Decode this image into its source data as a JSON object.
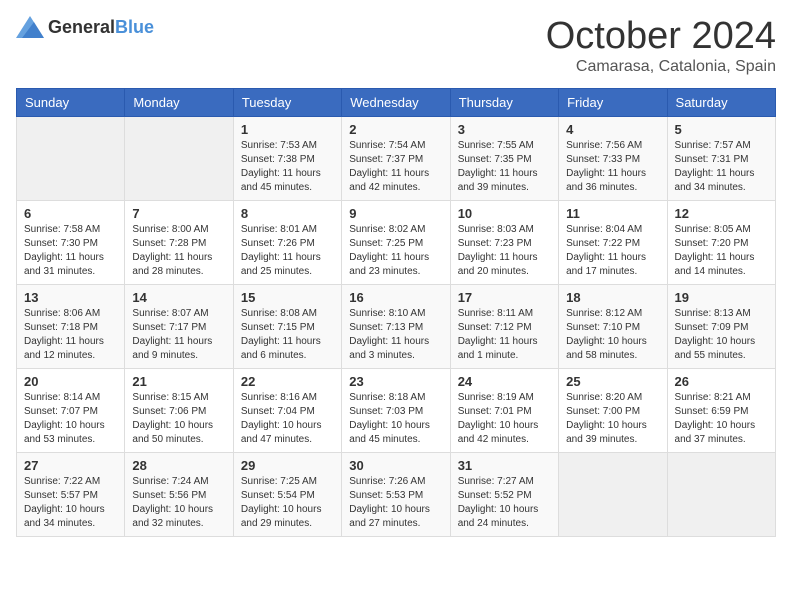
{
  "logo": {
    "general": "General",
    "blue": "Blue"
  },
  "header": {
    "month": "October 2024",
    "location": "Camarasa, Catalonia, Spain"
  },
  "weekdays": [
    "Sunday",
    "Monday",
    "Tuesday",
    "Wednesday",
    "Thursday",
    "Friday",
    "Saturday"
  ],
  "weeks": [
    [
      {
        "day": "",
        "sunrise": "",
        "sunset": "",
        "daylight": ""
      },
      {
        "day": "",
        "sunrise": "",
        "sunset": "",
        "daylight": ""
      },
      {
        "day": "1",
        "sunrise": "Sunrise: 7:53 AM",
        "sunset": "Sunset: 7:38 PM",
        "daylight": "Daylight: 11 hours and 45 minutes."
      },
      {
        "day": "2",
        "sunrise": "Sunrise: 7:54 AM",
        "sunset": "Sunset: 7:37 PM",
        "daylight": "Daylight: 11 hours and 42 minutes."
      },
      {
        "day": "3",
        "sunrise": "Sunrise: 7:55 AM",
        "sunset": "Sunset: 7:35 PM",
        "daylight": "Daylight: 11 hours and 39 minutes."
      },
      {
        "day": "4",
        "sunrise": "Sunrise: 7:56 AM",
        "sunset": "Sunset: 7:33 PM",
        "daylight": "Daylight: 11 hours and 36 minutes."
      },
      {
        "day": "5",
        "sunrise": "Sunrise: 7:57 AM",
        "sunset": "Sunset: 7:31 PM",
        "daylight": "Daylight: 11 hours and 34 minutes."
      }
    ],
    [
      {
        "day": "6",
        "sunrise": "Sunrise: 7:58 AM",
        "sunset": "Sunset: 7:30 PM",
        "daylight": "Daylight: 11 hours and 31 minutes."
      },
      {
        "day": "7",
        "sunrise": "Sunrise: 8:00 AM",
        "sunset": "Sunset: 7:28 PM",
        "daylight": "Daylight: 11 hours and 28 minutes."
      },
      {
        "day": "8",
        "sunrise": "Sunrise: 8:01 AM",
        "sunset": "Sunset: 7:26 PM",
        "daylight": "Daylight: 11 hours and 25 minutes."
      },
      {
        "day": "9",
        "sunrise": "Sunrise: 8:02 AM",
        "sunset": "Sunset: 7:25 PM",
        "daylight": "Daylight: 11 hours and 23 minutes."
      },
      {
        "day": "10",
        "sunrise": "Sunrise: 8:03 AM",
        "sunset": "Sunset: 7:23 PM",
        "daylight": "Daylight: 11 hours and 20 minutes."
      },
      {
        "day": "11",
        "sunrise": "Sunrise: 8:04 AM",
        "sunset": "Sunset: 7:22 PM",
        "daylight": "Daylight: 11 hours and 17 minutes."
      },
      {
        "day": "12",
        "sunrise": "Sunrise: 8:05 AM",
        "sunset": "Sunset: 7:20 PM",
        "daylight": "Daylight: 11 hours and 14 minutes."
      }
    ],
    [
      {
        "day": "13",
        "sunrise": "Sunrise: 8:06 AM",
        "sunset": "Sunset: 7:18 PM",
        "daylight": "Daylight: 11 hours and 12 minutes."
      },
      {
        "day": "14",
        "sunrise": "Sunrise: 8:07 AM",
        "sunset": "Sunset: 7:17 PM",
        "daylight": "Daylight: 11 hours and 9 minutes."
      },
      {
        "day": "15",
        "sunrise": "Sunrise: 8:08 AM",
        "sunset": "Sunset: 7:15 PM",
        "daylight": "Daylight: 11 hours and 6 minutes."
      },
      {
        "day": "16",
        "sunrise": "Sunrise: 8:10 AM",
        "sunset": "Sunset: 7:13 PM",
        "daylight": "Daylight: 11 hours and 3 minutes."
      },
      {
        "day": "17",
        "sunrise": "Sunrise: 8:11 AM",
        "sunset": "Sunset: 7:12 PM",
        "daylight": "Daylight: 11 hours and 1 minute."
      },
      {
        "day": "18",
        "sunrise": "Sunrise: 8:12 AM",
        "sunset": "Sunset: 7:10 PM",
        "daylight": "Daylight: 10 hours and 58 minutes."
      },
      {
        "day": "19",
        "sunrise": "Sunrise: 8:13 AM",
        "sunset": "Sunset: 7:09 PM",
        "daylight": "Daylight: 10 hours and 55 minutes."
      }
    ],
    [
      {
        "day": "20",
        "sunrise": "Sunrise: 8:14 AM",
        "sunset": "Sunset: 7:07 PM",
        "daylight": "Daylight: 10 hours and 53 minutes."
      },
      {
        "day": "21",
        "sunrise": "Sunrise: 8:15 AM",
        "sunset": "Sunset: 7:06 PM",
        "daylight": "Daylight: 10 hours and 50 minutes."
      },
      {
        "day": "22",
        "sunrise": "Sunrise: 8:16 AM",
        "sunset": "Sunset: 7:04 PM",
        "daylight": "Daylight: 10 hours and 47 minutes."
      },
      {
        "day": "23",
        "sunrise": "Sunrise: 8:18 AM",
        "sunset": "Sunset: 7:03 PM",
        "daylight": "Daylight: 10 hours and 45 minutes."
      },
      {
        "day": "24",
        "sunrise": "Sunrise: 8:19 AM",
        "sunset": "Sunset: 7:01 PM",
        "daylight": "Daylight: 10 hours and 42 minutes."
      },
      {
        "day": "25",
        "sunrise": "Sunrise: 8:20 AM",
        "sunset": "Sunset: 7:00 PM",
        "daylight": "Daylight: 10 hours and 39 minutes."
      },
      {
        "day": "26",
        "sunrise": "Sunrise: 8:21 AM",
        "sunset": "Sunset: 6:59 PM",
        "daylight": "Daylight: 10 hours and 37 minutes."
      }
    ],
    [
      {
        "day": "27",
        "sunrise": "Sunrise: 7:22 AM",
        "sunset": "Sunset: 5:57 PM",
        "daylight": "Daylight: 10 hours and 34 minutes."
      },
      {
        "day": "28",
        "sunrise": "Sunrise: 7:24 AM",
        "sunset": "Sunset: 5:56 PM",
        "daylight": "Daylight: 10 hours and 32 minutes."
      },
      {
        "day": "29",
        "sunrise": "Sunrise: 7:25 AM",
        "sunset": "Sunset: 5:54 PM",
        "daylight": "Daylight: 10 hours and 29 minutes."
      },
      {
        "day": "30",
        "sunrise": "Sunrise: 7:26 AM",
        "sunset": "Sunset: 5:53 PM",
        "daylight": "Daylight: 10 hours and 27 minutes."
      },
      {
        "day": "31",
        "sunrise": "Sunrise: 7:27 AM",
        "sunset": "Sunset: 5:52 PM",
        "daylight": "Daylight: 10 hours and 24 minutes."
      },
      {
        "day": "",
        "sunrise": "",
        "sunset": "",
        "daylight": ""
      },
      {
        "day": "",
        "sunrise": "",
        "sunset": "",
        "daylight": ""
      }
    ]
  ]
}
